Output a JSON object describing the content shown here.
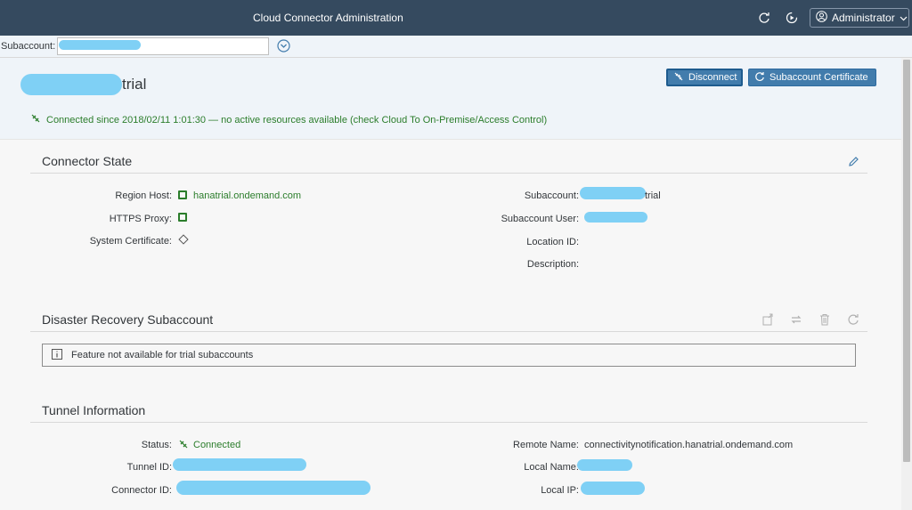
{
  "shell": {
    "title": "Cloud Connector Administration",
    "user_label": "Administrator",
    "icons": [
      "refresh-icon",
      "play-icon",
      "user-icon",
      "chevron-down-icon"
    ]
  },
  "subaccount_bar": {
    "label": "Subaccount:"
  },
  "header": {
    "title_suffix": "trial",
    "disconnect_label": "Disconnect",
    "certificate_label": "Subaccount Certificate",
    "status_text": "Connected since 2018/02/11 1:01:30 — no active resources available (check Cloud To On-Premise/Access Control)"
  },
  "connector_state": {
    "title": "Connector State",
    "region_host_label": "Region Host:",
    "region_host_value": "hanatrial.ondemand.com",
    "https_proxy_label": "HTTPS Proxy:",
    "system_cert_label": "System Certificate:",
    "subaccount_label": "Subaccount:",
    "subaccount_value_suffix": "trial",
    "subaccount_user_label": "Subaccount User:",
    "location_id_label": "Location ID:",
    "description_label": "Description:"
  },
  "disaster_recovery": {
    "title": "Disaster Recovery Subaccount",
    "info_text": "Feature not available for trial subaccounts"
  },
  "tunnel": {
    "title": "Tunnel Information",
    "status_label": "Status:",
    "status_value": "Connected",
    "tunnel_id_label": "Tunnel ID:",
    "connector_id_label": "Connector ID:",
    "remote_name_label": "Remote Name:",
    "remote_name_value": "connectivitynotification.hanatrial.ondemand.com",
    "local_name_label": "Local Name:",
    "local_ip_label": "Local IP:"
  },
  "colors": {
    "shell": "#354a5f",
    "accent": "#427cac",
    "success": "#2b7d2b",
    "redaction": "#7fd0f5"
  }
}
